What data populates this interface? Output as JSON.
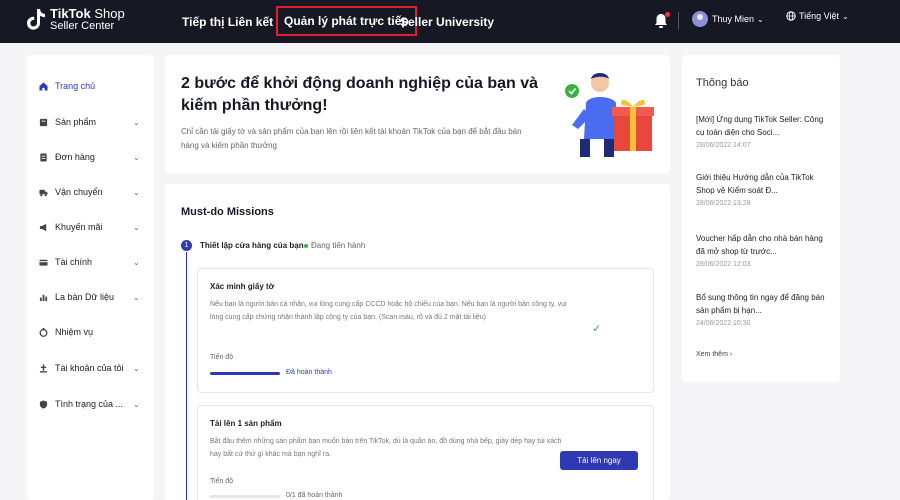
{
  "header": {
    "brand": "TikTok",
    "brand_suffix": "Shop",
    "brand_sub": "Seller Center",
    "nav": [
      "Tiếp thị Liên kết",
      "Quản lý phát trực tiếp",
      "Seller University"
    ],
    "user_name": "Thuy Mien",
    "language": "Tiếng Việt"
  },
  "sidebar": {
    "items": [
      {
        "label": "Trang chủ",
        "icon": "home-icon",
        "active": true
      },
      {
        "label": "Sản phẩm",
        "icon": "product-icon"
      },
      {
        "label": "Đơn hàng",
        "icon": "order-icon"
      },
      {
        "label": "Vận chuyển",
        "icon": "shipping-icon"
      },
      {
        "label": "Khuyến mãi",
        "icon": "promotion-icon"
      },
      {
        "label": "Tài chính",
        "icon": "finance-icon"
      },
      {
        "label": "La bàn Dữ liệu",
        "icon": "compass-icon"
      },
      {
        "label": "Nhiệm vụ",
        "icon": "mission-icon"
      },
      {
        "label": "Tài khoản của tôi",
        "icon": "account-icon"
      },
      {
        "label": "Tình trạng của ...",
        "icon": "status-icon"
      }
    ]
  },
  "hero": {
    "title": "2 bước để khởi động doanh nghiệp của bạn và kiếm phần thưởng!",
    "description": "Chỉ cần tải giấy tờ và sản phẩm của bạn lên rồi liên kết tài khoản TikTok của bạn để bắt đầu bán hàng và kiếm phần thưởng"
  },
  "missions": {
    "title": "Must-do Missions",
    "step_number": "1",
    "step_label": "Thiết lập cửa hàng của bạn",
    "step_status": "Đang tiến hành",
    "tasks": [
      {
        "title": "Xác minh giấy tờ",
        "description": "Nếu bạn là người bán cá nhân, vui lòng cung cấp CCCD hoặc hộ chiếu của bạn. Nếu bạn là người bán công ty, vui lòng cung cấp chứng nhận thành lập công ty của bạn. (Scan màu, rõ và đủ 2 mặt tài liệu)",
        "progress_label": "Tiến độ",
        "progress": 1,
        "progress_text": "Đã hoàn thành"
      },
      {
        "title": "Tải lên 1 sản phẩm",
        "description": "Bắt đầu thêm những sản phẩm bạn muốn bán trên TikTok, dù là quần áo, đồ dùng nhà bếp, giày dép hay túi xách hay bất cứ thứ gì khác mà bạn nghĩ ra.",
        "progress_label": "Tiến độ",
        "progress": 0,
        "progress_text": "0/1 đã hoàn thành",
        "button": "Tải lên ngay"
      }
    ]
  },
  "notifications": {
    "title": "Thông báo",
    "items": [
      {
        "title": "[Mới] Ứng dụng TikTok Seller: Công cụ toàn diện cho Soci...",
        "date": "28/06/2022 14:07"
      },
      {
        "title": "Giới thiệu Hướng dẫn của TikTok Shop về Kiểm soát Đ...",
        "date": "28/06/2022 13:28"
      },
      {
        "title": "Voucher hấp dẫn cho nhà bán hàng đã mở shop từ trước...",
        "date": "28/06/2022 12:03"
      },
      {
        "title": "Bổ sung thông tin ngay để đăng bán sản phẩm bị hạn...",
        "date": "24/06/2022 10:30"
      }
    ],
    "more": "Xem thêm"
  },
  "colors": {
    "accent": "#2f3ab2",
    "header_bg": "#161823",
    "highlight": "#e01e2b",
    "success": "#3cb043"
  }
}
